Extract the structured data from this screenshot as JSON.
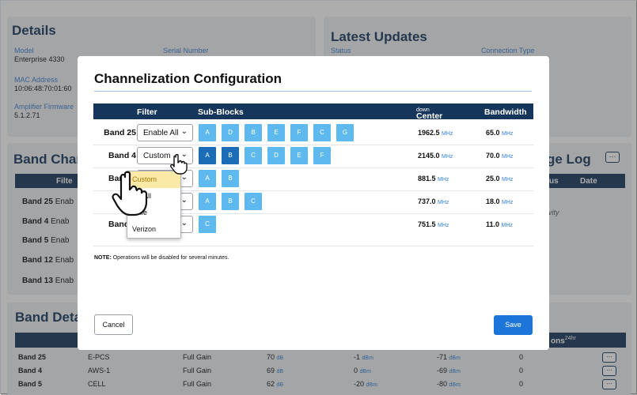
{
  "details": {
    "title": "Details",
    "model_label": "Model",
    "model": "Enterprise 4330",
    "serial_label": "Serial Number",
    "mac_label": "MAC Address",
    "mac": "10:06:48:70:01:60",
    "fw_label": "Amplifier Firmware",
    "fw": "5.1.2.71"
  },
  "updates": {
    "title": "Latest Updates",
    "status_label": "Status",
    "conn_label": "Connection Type"
  },
  "band_channel": {
    "title": "Band Chan",
    "filter_header": "Filte",
    "rows": [
      {
        "band": "Band 25",
        "filter": "Enab"
      },
      {
        "band": "Band 4",
        "filter": "Enab"
      },
      {
        "band": "Band 5",
        "filter": "Enab"
      },
      {
        "band": "Band 12",
        "filter": "Enab"
      },
      {
        "band": "Band 13",
        "filter": "Enab"
      }
    ]
  },
  "change_log": {
    "title": "ge Log",
    "more": "···",
    "col1": "us",
    "col2": "Date",
    "empty": "vity"
  },
  "band_details": {
    "title": "Band Detai",
    "header_right": "ons",
    "header_sup": "24hr",
    "rows": [
      {
        "band": "Band 25",
        "name": "E-PCS",
        "gain": "Full Gain",
        "v1": "70",
        "u1": "dB",
        "v2": "-1",
        "u2": "dBm",
        "v3": "-71",
        "u3": "dBm",
        "count": "0"
      },
      {
        "band": "Band 4",
        "name": "AWS-1",
        "gain": "Full Gain",
        "v1": "69",
        "u1": "dB",
        "v2": "0",
        "u2": "dBm",
        "v3": "-69",
        "u3": "dBm",
        "count": "0"
      },
      {
        "band": "Band 5",
        "name": "CELL",
        "gain": "Full Gain",
        "v1": "62",
        "u1": "dB",
        "v2": "-20",
        "u2": "dBm",
        "v3": "-80",
        "u3": "dBm",
        "count": "0"
      }
    ]
  },
  "modal": {
    "title": "Channelization Configuration",
    "headers": {
      "filter": "Filter",
      "subblocks": "Sub-Blocks",
      "freq": "Center Freq",
      "freq_sup": "down",
      "bw": "Bandwidth"
    },
    "rows": [
      {
        "band": "Band 25",
        "filter": "Enable All",
        "blocks": [
          "A",
          "D",
          "B",
          "E",
          "F",
          "C",
          "G"
        ],
        "freq": "1962.5",
        "bw": "65.0"
      },
      {
        "band": "Band 4",
        "filter": "Custom",
        "blocks": [
          "A",
          "B",
          "C",
          "D",
          "E",
          "F"
        ],
        "freq": "2145.0",
        "bw": "70.0"
      },
      {
        "band": "Band 5",
        "filter": "",
        "blocks": [
          "A",
          "B"
        ],
        "freq": "881.5",
        "bw": "25.0"
      },
      {
        "band": "Ban",
        "filter": "",
        "blocks": [
          "A",
          "B",
          "C"
        ],
        "freq": "737.0",
        "bw": "18.0"
      },
      {
        "band": "Band 1",
        "filter": "",
        "blocks": [
          "C"
        ],
        "freq": "751.5",
        "bw": "11.0"
      }
    ],
    "unit_mhz": "MHz",
    "note_bold": "NOTE:",
    "note": "Operations will be disabled for several minutes.",
    "cancel": "Cancel",
    "save": "Save",
    "dropdown": [
      "Custom",
      "ble All",
      "obile",
      "Verizon"
    ]
  }
}
